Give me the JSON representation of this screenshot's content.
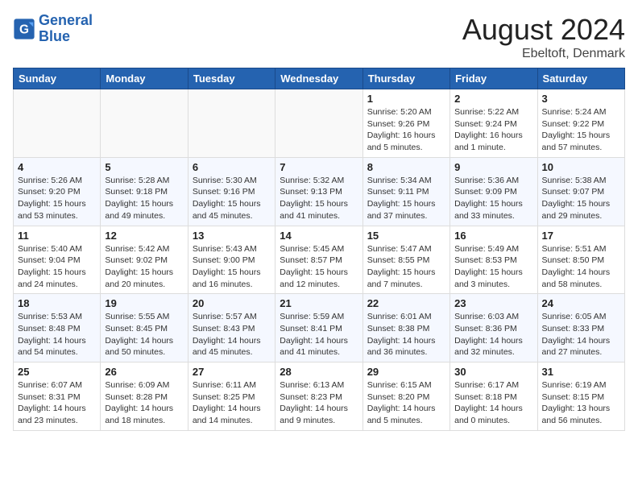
{
  "header": {
    "logo_line1": "General",
    "logo_line2": "Blue",
    "month_year": "August 2024",
    "location": "Ebeltoft, Denmark"
  },
  "days_of_week": [
    "Sunday",
    "Monday",
    "Tuesday",
    "Wednesday",
    "Thursday",
    "Friday",
    "Saturday"
  ],
  "weeks": [
    [
      {
        "day": "",
        "info": ""
      },
      {
        "day": "",
        "info": ""
      },
      {
        "day": "",
        "info": ""
      },
      {
        "day": "",
        "info": ""
      },
      {
        "day": "1",
        "info": "Sunrise: 5:20 AM\nSunset: 9:26 PM\nDaylight: 16 hours\nand 5 minutes."
      },
      {
        "day": "2",
        "info": "Sunrise: 5:22 AM\nSunset: 9:24 PM\nDaylight: 16 hours\nand 1 minute."
      },
      {
        "day": "3",
        "info": "Sunrise: 5:24 AM\nSunset: 9:22 PM\nDaylight: 15 hours\nand 57 minutes."
      }
    ],
    [
      {
        "day": "4",
        "info": "Sunrise: 5:26 AM\nSunset: 9:20 PM\nDaylight: 15 hours\nand 53 minutes."
      },
      {
        "day": "5",
        "info": "Sunrise: 5:28 AM\nSunset: 9:18 PM\nDaylight: 15 hours\nand 49 minutes."
      },
      {
        "day": "6",
        "info": "Sunrise: 5:30 AM\nSunset: 9:16 PM\nDaylight: 15 hours\nand 45 minutes."
      },
      {
        "day": "7",
        "info": "Sunrise: 5:32 AM\nSunset: 9:13 PM\nDaylight: 15 hours\nand 41 minutes."
      },
      {
        "day": "8",
        "info": "Sunrise: 5:34 AM\nSunset: 9:11 PM\nDaylight: 15 hours\nand 37 minutes."
      },
      {
        "day": "9",
        "info": "Sunrise: 5:36 AM\nSunset: 9:09 PM\nDaylight: 15 hours\nand 33 minutes."
      },
      {
        "day": "10",
        "info": "Sunrise: 5:38 AM\nSunset: 9:07 PM\nDaylight: 15 hours\nand 29 minutes."
      }
    ],
    [
      {
        "day": "11",
        "info": "Sunrise: 5:40 AM\nSunset: 9:04 PM\nDaylight: 15 hours\nand 24 minutes."
      },
      {
        "day": "12",
        "info": "Sunrise: 5:42 AM\nSunset: 9:02 PM\nDaylight: 15 hours\nand 20 minutes."
      },
      {
        "day": "13",
        "info": "Sunrise: 5:43 AM\nSunset: 9:00 PM\nDaylight: 15 hours\nand 16 minutes."
      },
      {
        "day": "14",
        "info": "Sunrise: 5:45 AM\nSunset: 8:57 PM\nDaylight: 15 hours\nand 12 minutes."
      },
      {
        "day": "15",
        "info": "Sunrise: 5:47 AM\nSunset: 8:55 PM\nDaylight: 15 hours\nand 7 minutes."
      },
      {
        "day": "16",
        "info": "Sunrise: 5:49 AM\nSunset: 8:53 PM\nDaylight: 15 hours\nand 3 minutes."
      },
      {
        "day": "17",
        "info": "Sunrise: 5:51 AM\nSunset: 8:50 PM\nDaylight: 14 hours\nand 58 minutes."
      }
    ],
    [
      {
        "day": "18",
        "info": "Sunrise: 5:53 AM\nSunset: 8:48 PM\nDaylight: 14 hours\nand 54 minutes."
      },
      {
        "day": "19",
        "info": "Sunrise: 5:55 AM\nSunset: 8:45 PM\nDaylight: 14 hours\nand 50 minutes."
      },
      {
        "day": "20",
        "info": "Sunrise: 5:57 AM\nSunset: 8:43 PM\nDaylight: 14 hours\nand 45 minutes."
      },
      {
        "day": "21",
        "info": "Sunrise: 5:59 AM\nSunset: 8:41 PM\nDaylight: 14 hours\nand 41 minutes."
      },
      {
        "day": "22",
        "info": "Sunrise: 6:01 AM\nSunset: 8:38 PM\nDaylight: 14 hours\nand 36 minutes."
      },
      {
        "day": "23",
        "info": "Sunrise: 6:03 AM\nSunset: 8:36 PM\nDaylight: 14 hours\nand 32 minutes."
      },
      {
        "day": "24",
        "info": "Sunrise: 6:05 AM\nSunset: 8:33 PM\nDaylight: 14 hours\nand 27 minutes."
      }
    ],
    [
      {
        "day": "25",
        "info": "Sunrise: 6:07 AM\nSunset: 8:31 PM\nDaylight: 14 hours\nand 23 minutes."
      },
      {
        "day": "26",
        "info": "Sunrise: 6:09 AM\nSunset: 8:28 PM\nDaylight: 14 hours\nand 18 minutes."
      },
      {
        "day": "27",
        "info": "Sunrise: 6:11 AM\nSunset: 8:25 PM\nDaylight: 14 hours\nand 14 minutes."
      },
      {
        "day": "28",
        "info": "Sunrise: 6:13 AM\nSunset: 8:23 PM\nDaylight: 14 hours\nand 9 minutes."
      },
      {
        "day": "29",
        "info": "Sunrise: 6:15 AM\nSunset: 8:20 PM\nDaylight: 14 hours\nand 5 minutes."
      },
      {
        "day": "30",
        "info": "Sunrise: 6:17 AM\nSunset: 8:18 PM\nDaylight: 14 hours\nand 0 minutes."
      },
      {
        "day": "31",
        "info": "Sunrise: 6:19 AM\nSunset: 8:15 PM\nDaylight: 13 hours\nand 56 minutes."
      }
    ]
  ]
}
